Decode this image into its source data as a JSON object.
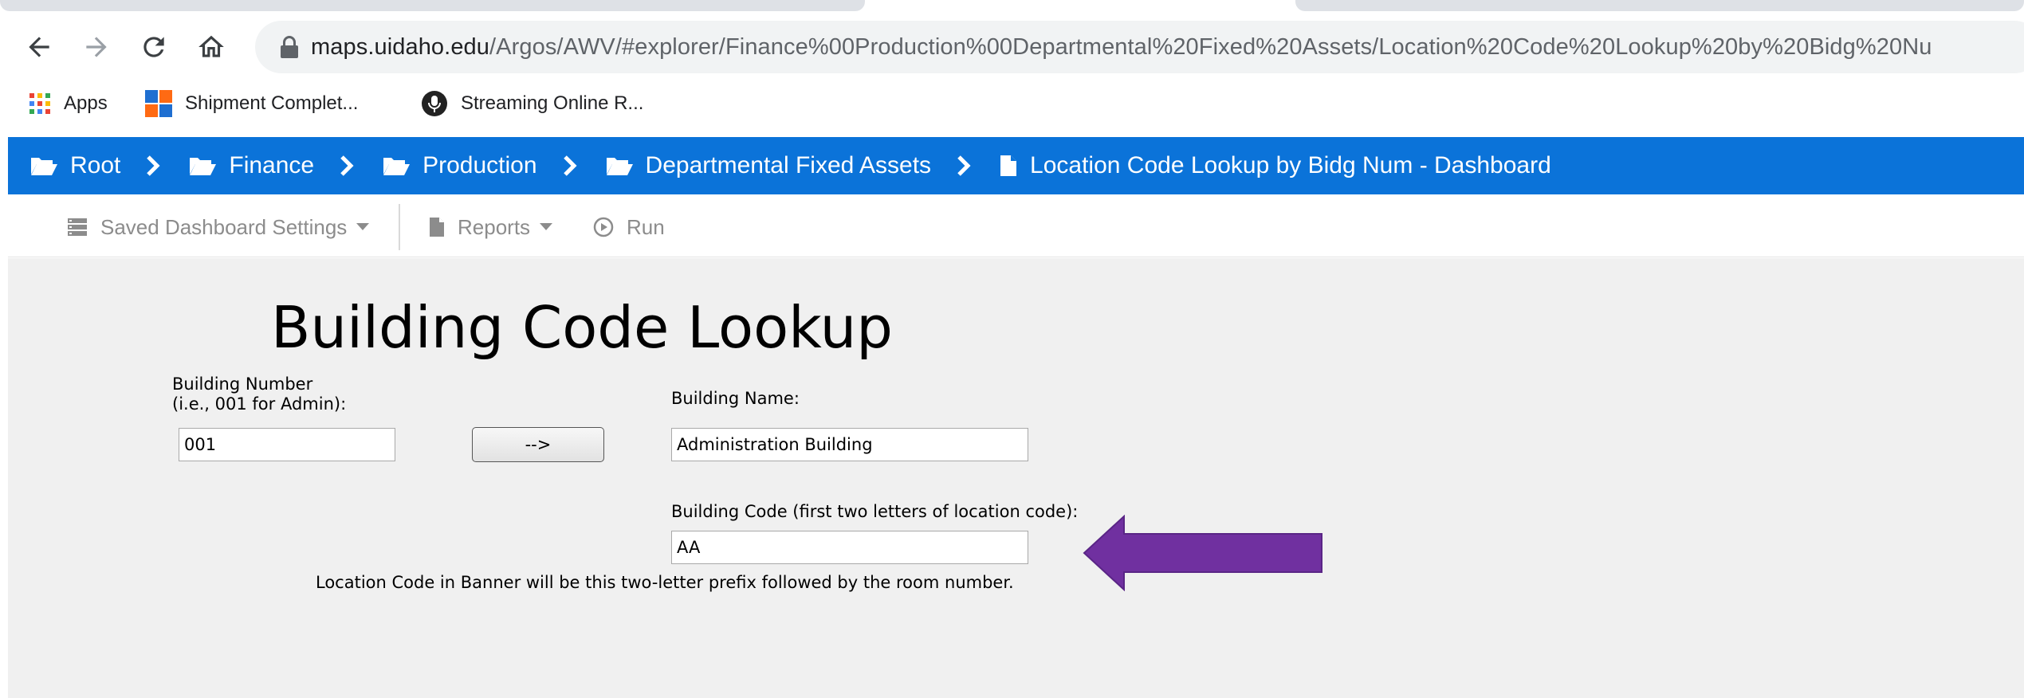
{
  "browser": {
    "url_host": "maps.uidaho.edu",
    "url_path": "/Argos/AWV/#explorer/Finance%00Production%00Departmental%20Fixed%20Assets/Location%20Code%20Lookup%20by%20Bidg%20Nu",
    "bookmarks": [
      {
        "label": "Apps",
        "icon": "apps-grid-icon"
      },
      {
        "label": "Shipment Complet...",
        "icon": "shipment-logo-icon"
      },
      {
        "label": "Streaming Online R...",
        "icon": "microphone-icon"
      }
    ]
  },
  "breadcrumb": {
    "items": [
      {
        "label": "Root",
        "icon": "folder-open-icon"
      },
      {
        "label": "Finance",
        "icon": "folder-open-icon"
      },
      {
        "label": "Production",
        "icon": "folder-open-icon"
      },
      {
        "label": "Departmental Fixed Assets",
        "icon": "folder-open-icon"
      },
      {
        "label": "Location Code Lookup by Bidg Num - Dashboard",
        "icon": "file-icon"
      }
    ],
    "separator_icon": "chevron-right-icon"
  },
  "toolbar": {
    "saved_settings_label": "Saved Dashboard Settings",
    "reports_label": "Reports",
    "run_label": "Run"
  },
  "dashboard": {
    "title": "Building Code Lookup",
    "building_number": {
      "label_line1": "Building Number",
      "label_line2": "(i.e., 001 for Admin):",
      "value": "001"
    },
    "go_button_label": "-->",
    "building_name": {
      "label": "Building Name:",
      "value": "Administration Building"
    },
    "building_code": {
      "label": "Building Code (first two letters of location code):",
      "value": "AA"
    },
    "note": "Location Code in Banner will be this two-letter prefix followed by the room number."
  },
  "colors": {
    "breadcrumb_bar": "#0b73d9",
    "canvas_background": "#f0f0f0",
    "annotation_arrow": "#7030a0",
    "toolbar_text": "#8c8c8c"
  }
}
